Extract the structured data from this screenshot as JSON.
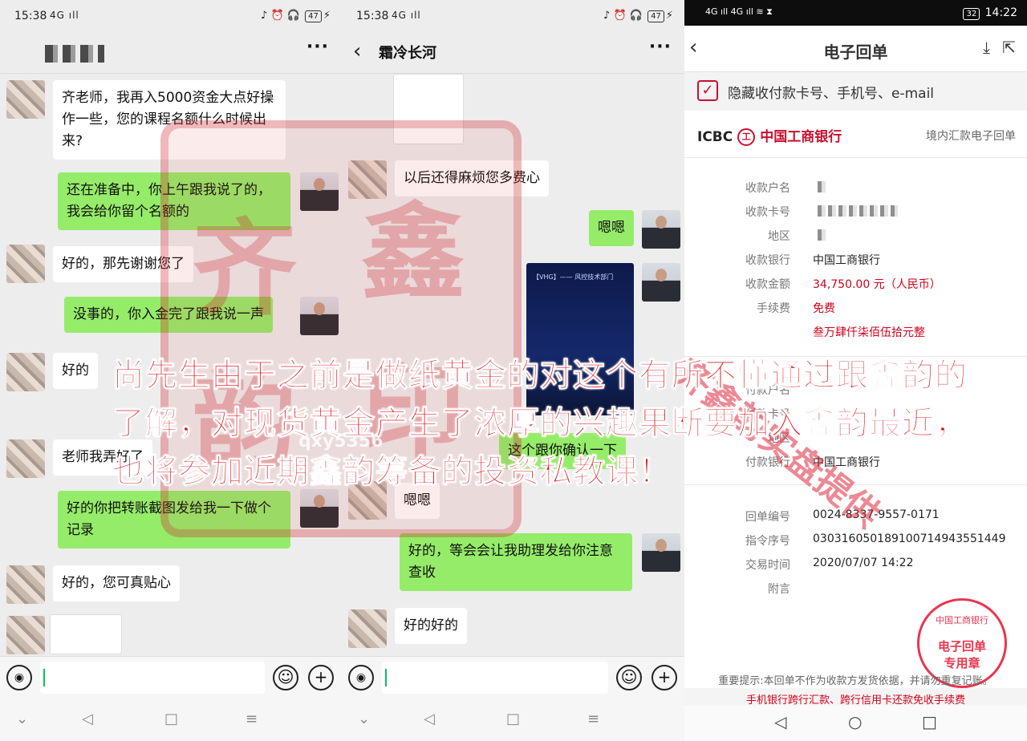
{
  "left": {
    "time": "15:38",
    "signal": "4G ıll",
    "status_right": "♪ ⏰ 🎧",
    "battery": "47",
    "messages": [
      {
        "text": "齐老师，我再入5000资金大点好操作一些，您的课程名额什么时候出来?"
      },
      {
        "text": "还在准备中，你上午跟我说了的，我会给你留个名额的"
      },
      {
        "text": "好的，那先谢谢您了"
      },
      {
        "text": "没事的，你入金完了跟我说一声"
      },
      {
        "text": "好的"
      },
      {
        "text": "老师我弄好了"
      },
      {
        "text": "好的你把转账截图发给我一下做个记录"
      },
      {
        "text": "好的，您可真贴心"
      }
    ]
  },
  "middle": {
    "time": "15:38",
    "title": "霜冷长河",
    "messages": [
      {
        "text": "以后还得麻烦您多费心"
      },
      {
        "text": "嗯嗯"
      },
      {
        "text": "这个跟你确认一下"
      },
      {
        "text": "嗯嗯"
      },
      {
        "text": "好的，等会会让我助理发给你注意查收"
      },
      {
        "text": "好的好的"
      }
    ],
    "poster_text": "【VHG】—— 风控技术部门",
    "watermark_id": "qxy5356"
  },
  "receipt": {
    "time": "14:22",
    "battery": "32",
    "title": "电子回单",
    "hide_label": "隐藏收付款卡号、手机号、e-mail",
    "bank_en": "ICBC",
    "bank_cn": "中国工商银行",
    "receipt_type": "境内汇款电子回单",
    "fields": {
      "payee_name_label": "收款户名",
      "payee_card_label": "收款卡号",
      "region_label": "地区",
      "payee_bank_label": "收款银行",
      "payee_bank_value": "中国工商银行",
      "amount_label": "收款金额",
      "amount_value": "34,750.00 元（人民币）",
      "fee_label": "手续费",
      "fee_value": "免费",
      "amount_words": "叁万肆仟柒佰伍拾元整",
      "payer_name_label": "付款户名",
      "payer_card_label": "付款卡号",
      "payer_region_label": "地区",
      "payer_bank_label": "付款银行",
      "payer_bank_value": "中国工商银行",
      "receipt_no_label": "回单编号",
      "receipt_no_value": "0024-8337-9557-0171",
      "order_no_label": "指令序号",
      "order_no_value": "0303160501891007149435514​49",
      "time_label": "交易时间",
      "time_value": "2020/07/07 14:22",
      "memo_label": "附言"
    },
    "stamp_top": "中国工商银行",
    "stamp_mid": "电子回单",
    "stamp_bottom": "专用章",
    "note_gray": "重要提示:本回单不作为收款方发货依据，并请勿重复记账。",
    "note_red": "手机银行跨行汇款、跨行信用卡还款免收手续费",
    "watermark": "齐鑫韵实盘提供"
  },
  "overlay": {
    "seal_chars": [
      "齐",
      "鑫",
      "韵",
      "印"
    ],
    "caption": "尚先生由于之前是做纸黄金的对这个有所不懂通过跟鑫韵的了解，对现货黄金产生了浓厚的兴趣果断要加入鑫韵最近，也将参加近期鑫韵筹备的投资私教课！"
  },
  "colors": {
    "wechat_green": "#95ec69",
    "icbc_red": "#c8102e",
    "caption_red": "#e0141c"
  }
}
